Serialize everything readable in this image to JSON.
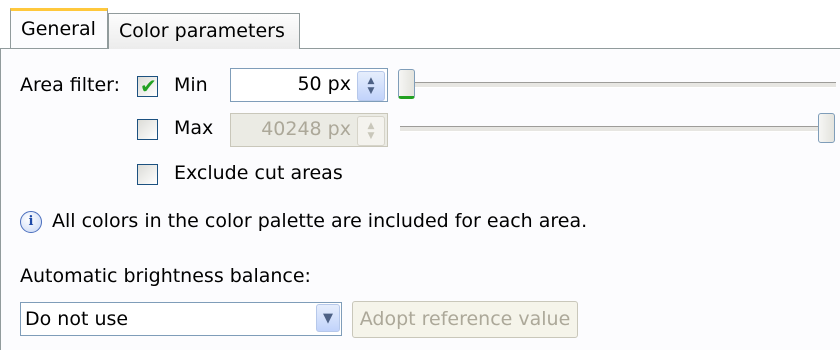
{
  "tabs": [
    {
      "label": "General",
      "active": true
    },
    {
      "label": "Color parameters",
      "active": false
    }
  ],
  "area_filter": {
    "label": "Area filter:",
    "min": {
      "label": "Min",
      "checked": true,
      "value": "50 px",
      "slider_fraction": 0.0
    },
    "max": {
      "label": "Max",
      "checked": false,
      "value": "40248 px",
      "slider_fraction": 1.0
    }
  },
  "exclude_cut_areas": {
    "label": "Exclude cut areas",
    "checked": false
  },
  "info": {
    "icon": "info-icon",
    "text": "All colors in the color palette are included for each area."
  },
  "brightness": {
    "label": "Automatic brightness balance:",
    "selected": "Do not use",
    "adopt_button": "Adopt reference value"
  },
  "colors": {
    "check": "#21a121",
    "accent_tab": "#ffc83c",
    "border": "#7f9db9"
  }
}
